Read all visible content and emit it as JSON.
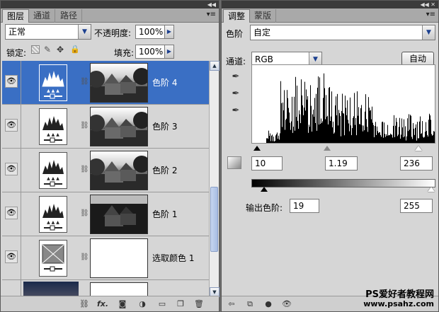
{
  "layers_panel": {
    "tabs": [
      "图层",
      "通道",
      "路径"
    ],
    "active_tab": 0,
    "blend_mode": "正常",
    "opacity_label": "不透明度:",
    "opacity_value": "100%",
    "lock_label": "锁定:",
    "fill_label": "填充:",
    "fill_value": "100%",
    "layers": [
      {
        "name": "色阶 4",
        "selected": true,
        "visible": true,
        "icon": "levels-adjustment-icon",
        "thumb": "photo"
      },
      {
        "name": "色阶 3",
        "selected": false,
        "visible": true,
        "icon": "levels-adjustment-icon",
        "thumb": "photo"
      },
      {
        "name": "色阶 2",
        "selected": false,
        "visible": true,
        "icon": "levels-adjustment-icon",
        "thumb": "photo"
      },
      {
        "name": "色阶 1",
        "selected": false,
        "visible": true,
        "icon": "levels-adjustment-icon",
        "thumb": "photo"
      },
      {
        "name": "选取颜色 1",
        "selected": false,
        "visible": true,
        "icon": "selective-color-adjustment-icon",
        "thumb": "white"
      }
    ]
  },
  "adjust_panel": {
    "tabs": [
      "调整",
      "蒙版"
    ],
    "active_tab": 0,
    "title": "色阶",
    "preset_value": "自定",
    "channel_label": "通道:",
    "channel_value": "RGB",
    "auto_label": "自动",
    "input_black": "10",
    "input_gamma": "1.19",
    "input_white": "236",
    "output_label": "输出色阶:",
    "output_black": "19",
    "output_white": "255"
  },
  "watermark": {
    "line1": "PS爱好者教程网",
    "line2": "www.psahz.com"
  },
  "colors": {
    "selected_layer": "#3a6fc4",
    "panel_bg": "#d6d6d6",
    "link_blue": "#1b3f8f"
  }
}
